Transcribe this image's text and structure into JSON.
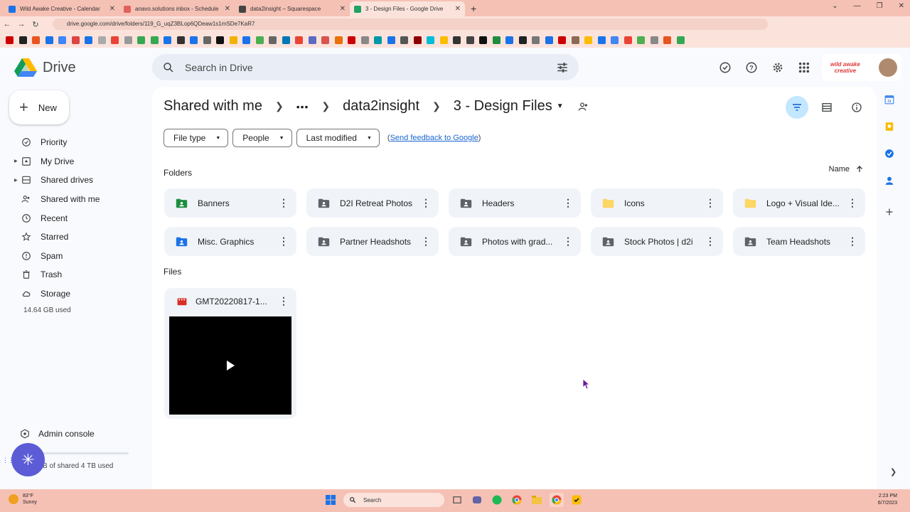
{
  "browser": {
    "tabs": [
      {
        "title": "Wild Awake Creative - Calendar",
        "color": "#1a73e8"
      },
      {
        "title": "anavo.solutions inbox - Schedule",
        "color": "#e0615a"
      },
      {
        "title": "data2insight – Squarespace",
        "color": "#444444"
      },
      {
        "title": "3 - Design Files - Google Drive",
        "color": "#1ea362",
        "active": true
      }
    ],
    "new_tab": "+",
    "url": "drive.google.com/drive/folders/119_G_uqZ3BLop6QDeaw1s1mSDe7KaR7"
  },
  "drive": {
    "brand": "Drive",
    "search_placeholder": "Search in Drive",
    "new_label": "New",
    "account_name_line1": "wild awake",
    "account_name_line2": "creative",
    "sidebar": [
      {
        "label": "Priority",
        "icon": "priority-icon"
      },
      {
        "label": "My Drive",
        "icon": "my-drive-icon",
        "expandable": true
      },
      {
        "label": "Shared drives",
        "icon": "shared-drives-icon",
        "expandable": true
      },
      {
        "label": "Shared with me",
        "icon": "shared-with-me-icon"
      },
      {
        "label": "Recent",
        "icon": "clock-icon"
      },
      {
        "label": "Starred",
        "icon": "star-icon"
      },
      {
        "label": "Spam",
        "icon": "spam-icon"
      },
      {
        "label": "Trash",
        "icon": "trash-icon"
      },
      {
        "label": "Storage",
        "icon": "cloud-icon"
      }
    ],
    "storage_used": "14.64 GB used",
    "admin_console": "Admin console",
    "shared_storage_used": "B of shared 4 TB used",
    "breadcrumb": {
      "root": "Shared with me",
      "ellipsis": "•••",
      "parent": "data2insight",
      "current": "3 - Design Files"
    },
    "filters": {
      "file_type": "File type",
      "people": "People",
      "last_modified": "Last modified",
      "feedback_prefix": "(",
      "feedback_link": "Send feedback to Google",
      "feedback_suffix": ")"
    },
    "folders_label": "Folders",
    "files_label": "Files",
    "sort_label": "Name",
    "folders": [
      {
        "name": "Banners",
        "color": "#1e8e3e"
      },
      {
        "name": "D2I Retreat Photos",
        "color": "#5f6368"
      },
      {
        "name": "Headers",
        "color": "#5f6368"
      },
      {
        "name": "Icons",
        "color": "#fdd663"
      },
      {
        "name": "Logo + Visual Ide...",
        "color": "#fdd663"
      },
      {
        "name": "Misc. Graphics",
        "color": "#1a73e8"
      },
      {
        "name": "Partner Headshots",
        "color": "#5f6368"
      },
      {
        "name": "Photos with grad...",
        "color": "#5f6368"
      },
      {
        "name": "Stock Photos | d2i",
        "color": "#5f6368"
      },
      {
        "name": "Team Headshots",
        "color": "#5f6368"
      }
    ],
    "files": [
      {
        "name": "GMT20220817-1..."
      }
    ]
  },
  "taskbar": {
    "temp": "83°F",
    "condition": "Sunny",
    "search": "Search",
    "time": "2:23 PM",
    "date": "6/7/2023"
  }
}
